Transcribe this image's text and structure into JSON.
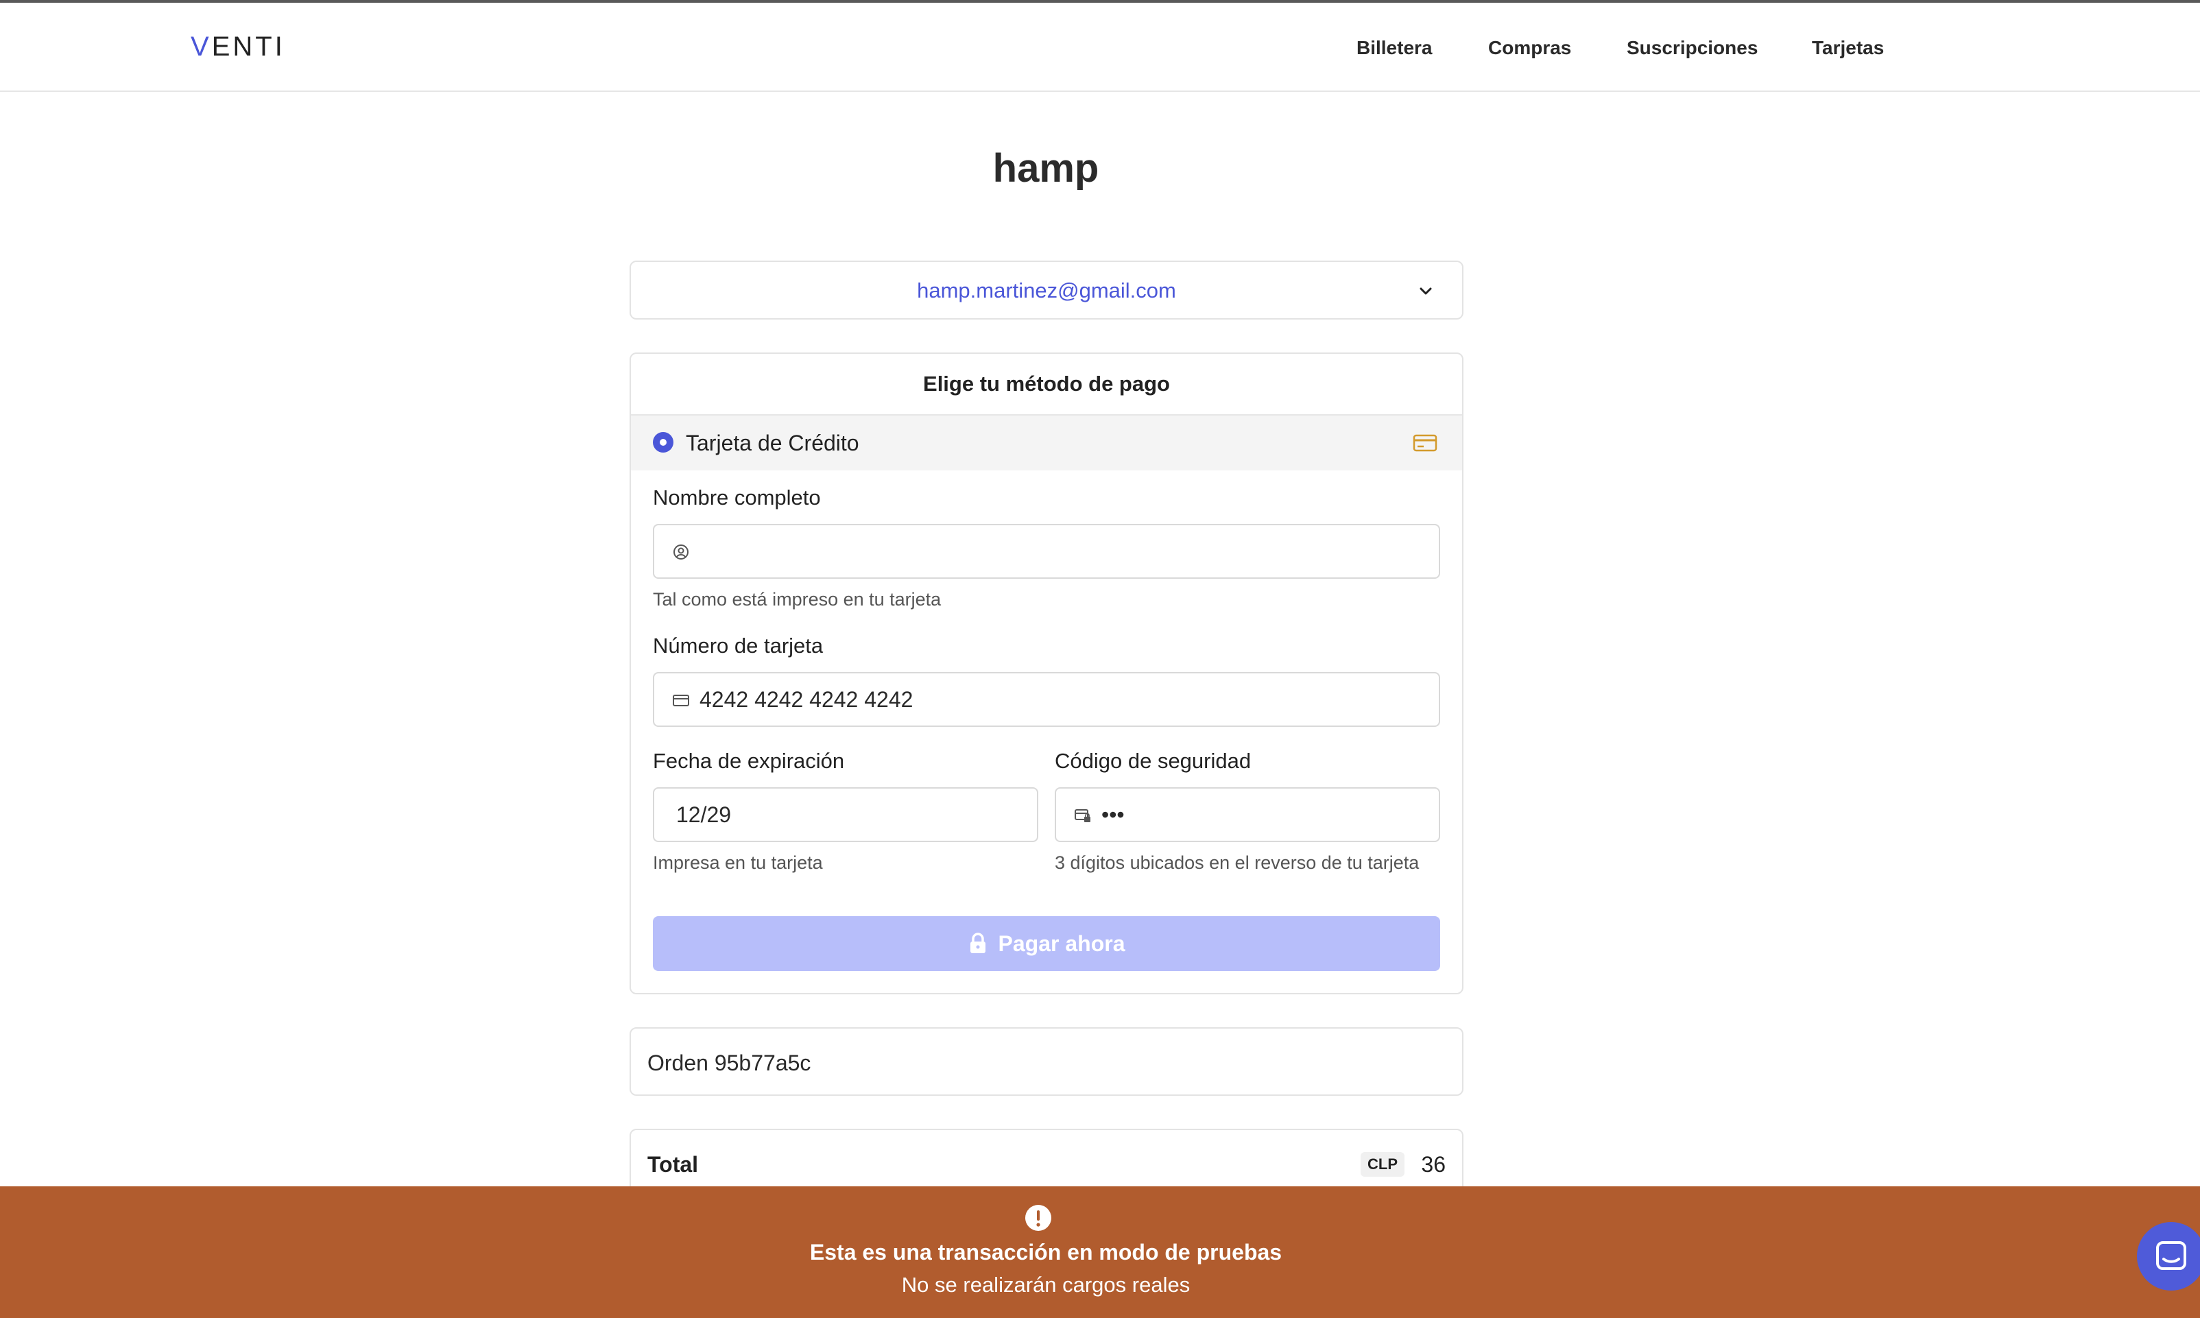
{
  "header": {
    "logo_v": "V",
    "logo_rest": "ENTI",
    "nav": [
      "Billetera",
      "Compras",
      "Suscripciones",
      "Tarjetas"
    ]
  },
  "page": {
    "title": "hamp"
  },
  "account": {
    "email": "hamp.martinez@gmail.com"
  },
  "payment": {
    "heading": "Elige tu método de pago",
    "method_label": "Tarjeta de Crédito",
    "name": {
      "label": "Nombre completo",
      "value": "",
      "help": "Tal como está impreso en tu tarjeta"
    },
    "card_number": {
      "label": "Número de tarjeta",
      "value": "4242 4242 4242 4242"
    },
    "expiry": {
      "label": "Fecha de expiración",
      "value": "12/29",
      "help": "Impresa en tu tarjeta"
    },
    "cvc": {
      "label": "Código de seguridad",
      "value": "•••",
      "help": "3 dígitos ubicados en el reverso de tu tarjeta"
    },
    "pay_button": "Pagar ahora"
  },
  "order": {
    "label": "Orden 95b77a5c"
  },
  "total": {
    "label": "Total",
    "currency": "CLP",
    "amount": "36"
  },
  "banner": {
    "title": "Esta es una transacción en modo de pruebas",
    "subtitle": "No se realizarán cargos reales"
  },
  "colors": {
    "accent": "#4a56d8",
    "banner": "#b15c2e",
    "button_disabled": "#b7befa",
    "card_icon": "#d39a2c"
  }
}
